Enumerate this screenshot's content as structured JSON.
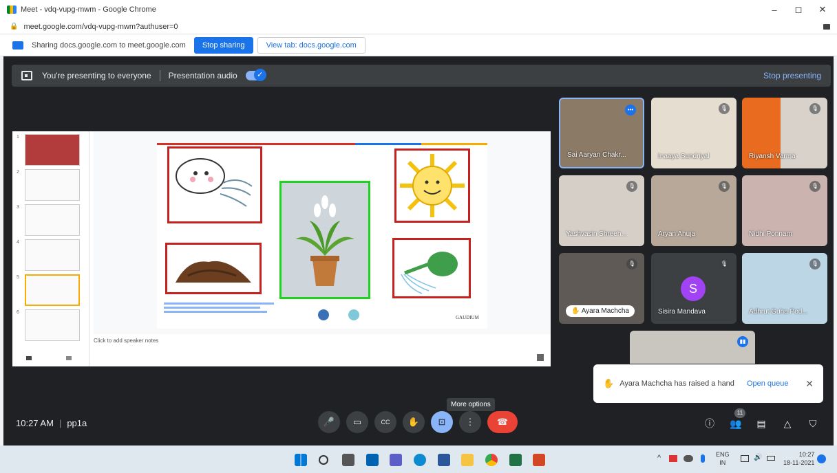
{
  "browser": {
    "tab_title": "Meet - vdq-vupg-mwm - Google Chrome",
    "url": "meet.google.com/vdq-vupg-mwm?authuser=0",
    "minimize": "–",
    "maximize": "◻",
    "close": "✕"
  },
  "share_bar": {
    "text": "Sharing docs.google.com to meet.google.com",
    "stop_label": "Stop sharing",
    "view_label": "View tab: docs.google.com"
  },
  "present_bar": {
    "text": "You're presenting to everyone",
    "audio_label": "Presentation audio",
    "stop_label": "Stop presenting"
  },
  "slides": {
    "thumb_numbers": [
      "1",
      "2",
      "3",
      "4",
      "5",
      "6"
    ],
    "speaker_notes": "Click to add speaker notes",
    "logo_text": "GAUDIUM"
  },
  "participants": [
    {
      "name": "Sai Aaryan Chakr..."
    },
    {
      "name": "Inaaya Sundriyal"
    },
    {
      "name": "Riyansh Varma"
    },
    {
      "name": "Yashvasin Shreeh..."
    },
    {
      "name": "Aryan Ahuja"
    },
    {
      "name": "Nidhi Ponnam"
    },
    {
      "name": "Ayara Machcha"
    },
    {
      "name": "Sisira Mandava",
      "initial": "S"
    },
    {
      "name": "Adhrut Guha Ped..."
    }
  ],
  "toast": {
    "text": "Ayara Machcha has raised a hand",
    "link": "Open queue"
  },
  "tooltip": "More options",
  "meeting": {
    "time": "10:27 AM",
    "code": "pp1a",
    "people_count": "11"
  },
  "taskbar": {
    "lang_top": "ENG",
    "lang_bottom": "IN",
    "clock_time": "10:27",
    "clock_date": "18-11-2021"
  }
}
